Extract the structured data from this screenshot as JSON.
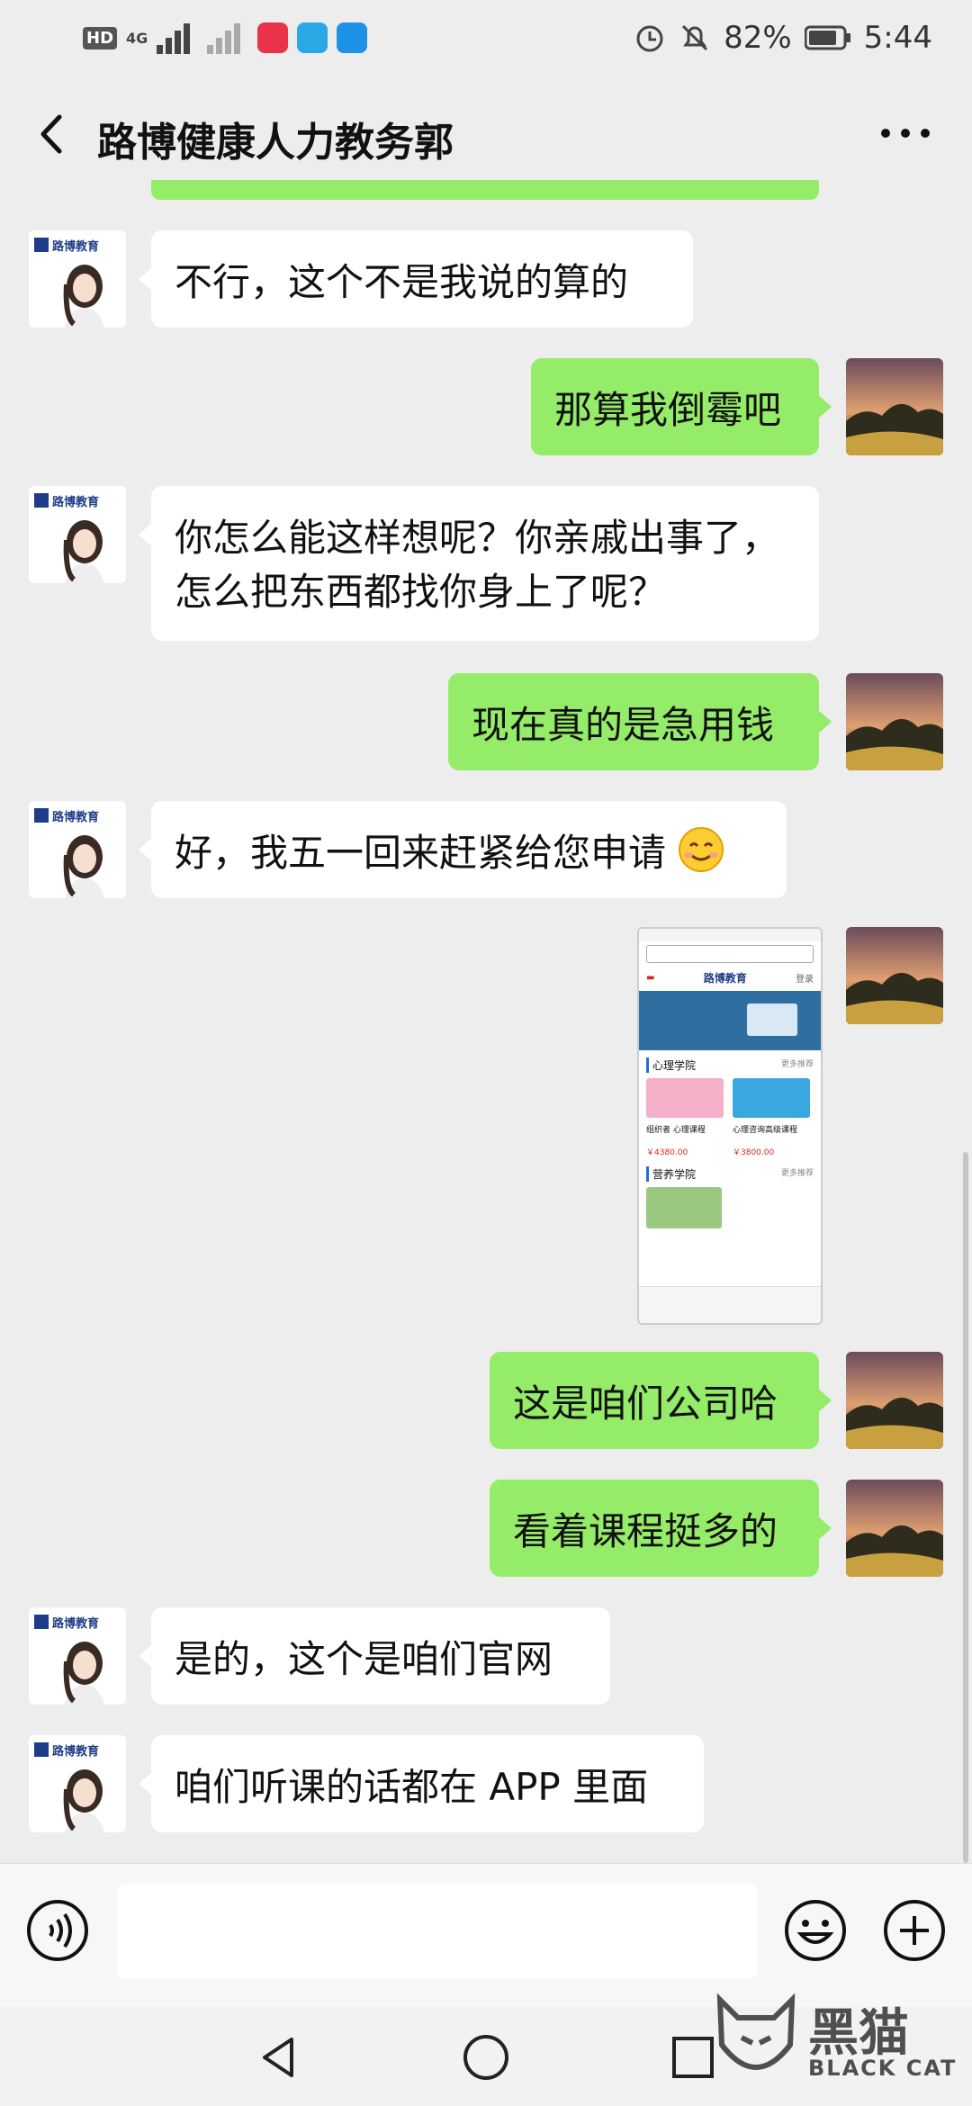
{
  "status_bar": {
    "battery": "82%",
    "time": "5:44",
    "hd_label": "HD",
    "net_label": "4G"
  },
  "header": {
    "title": "路博健康人力教务郭",
    "back_icon": "back-arrow-icon",
    "more_icon": "more-dots-icon"
  },
  "messages": [
    {
      "side": "left",
      "text": "不行，这个不是我说的算的"
    },
    {
      "side": "right",
      "text": "那算我倒霉吧"
    },
    {
      "side": "left",
      "line1": "你怎么能这样想呢？你亲戚出事了，",
      "line2": "怎么把东西都找你身上了呢？"
    },
    {
      "side": "right",
      "text": "现在真的是急用钱"
    },
    {
      "side": "left",
      "text": "好，我五一回来赶紧给您申请",
      "emoji": "smiling-face-emoji"
    },
    {
      "side": "right",
      "type": "image",
      "screenshot": {
        "logo": "路博教育",
        "login": "登录",
        "section1": "心理学院",
        "section1_more": "更多推荐",
        "course1": "组织者 心理课程",
        "price1": "￥4380.00",
        "course2": "心理咨询高级课程",
        "price2": "￥3800.00",
        "section2": "营养学院",
        "section2_more": "更多推荐"
      }
    },
    {
      "side": "right",
      "text": "这是咱们公司哈"
    },
    {
      "side": "right",
      "text": "看着课程挺多的"
    },
    {
      "side": "left",
      "text": "是的，这个是咱们官网"
    },
    {
      "side": "left",
      "text": "咱们听课的话都在 APP 里面"
    }
  ],
  "contact_avatar_logo": "路博教育",
  "watermark": {
    "cn": "黑猫",
    "en": "BLACK CAT"
  },
  "colors": {
    "sent_bubble": "#95ec69",
    "received_bubble": "#ffffff",
    "background": "#ededed"
  }
}
